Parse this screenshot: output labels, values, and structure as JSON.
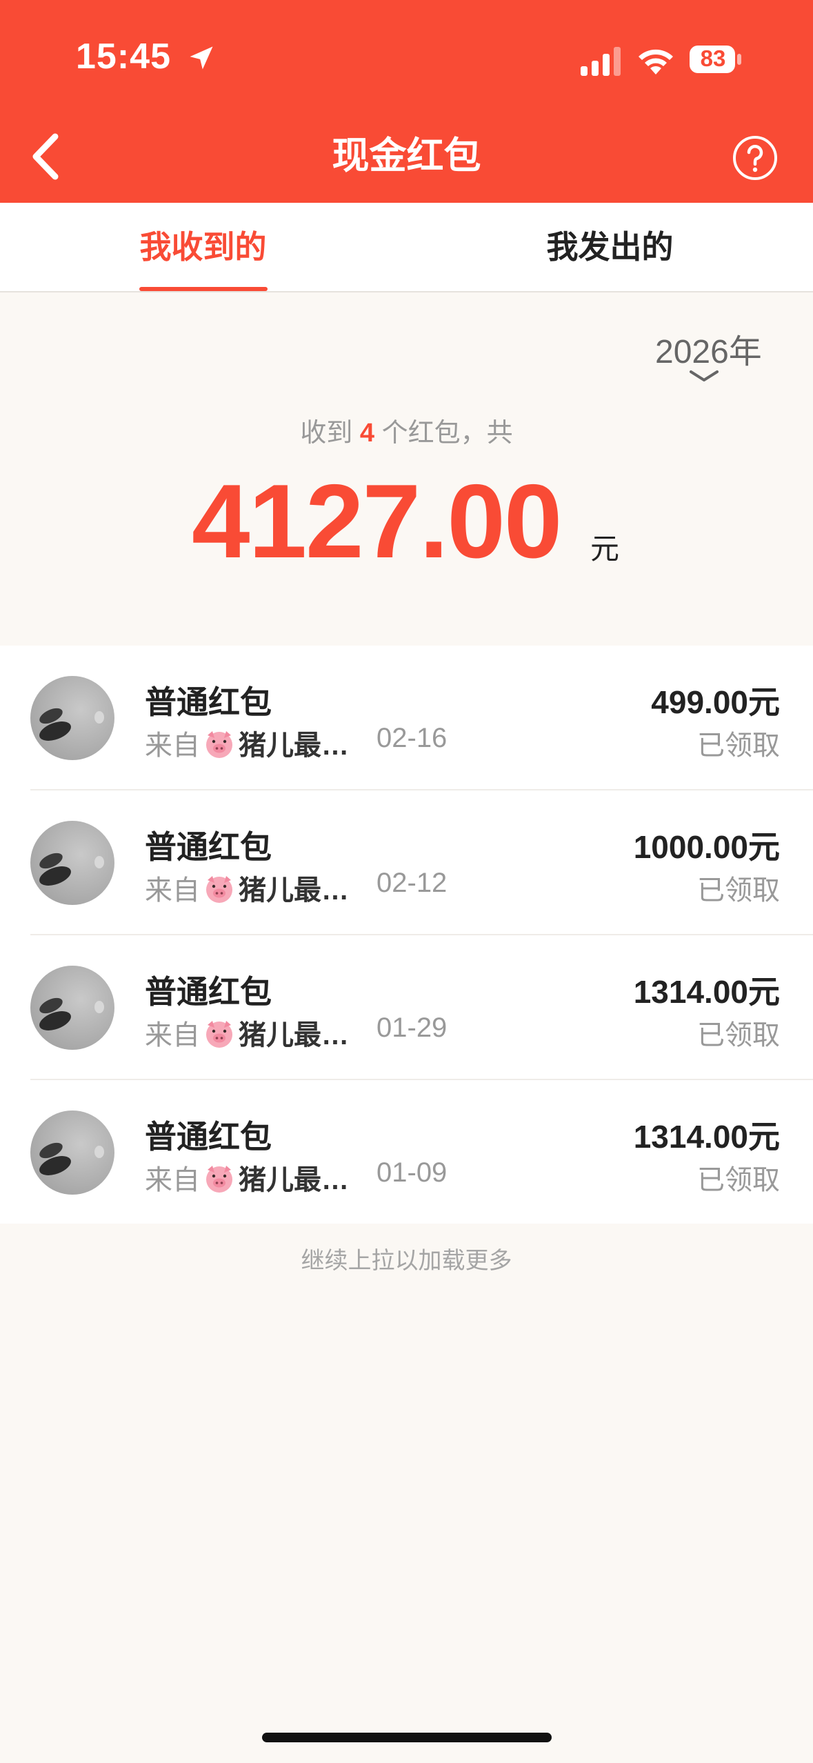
{
  "status_bar": {
    "time": "15:45",
    "battery": "83"
  },
  "nav": {
    "title": "现金红包"
  },
  "tabs": [
    {
      "label": "我收到的",
      "active": true
    },
    {
      "label": "我发出的",
      "active": false
    }
  ],
  "year_selector": {
    "value": "2026年"
  },
  "summary": {
    "prefix": "收到",
    "count": "4",
    "suffix": "个红包，共",
    "total": "4127.00",
    "unit": "元"
  },
  "records": [
    {
      "title": "普通红包",
      "from_prefix": "来自",
      "sender": "猪儿最…",
      "date": "02-16",
      "amount": "499.00元",
      "status": "已领取"
    },
    {
      "title": "普通红包",
      "from_prefix": "来自",
      "sender": "猪儿最…",
      "date": "02-12",
      "amount": "1000.00元",
      "status": "已领取"
    },
    {
      "title": "普通红包",
      "from_prefix": "来自",
      "sender": "猪儿最…",
      "date": "01-29",
      "amount": "1314.00元",
      "status": "已领取"
    },
    {
      "title": "普通红包",
      "from_prefix": "来自",
      "sender": "猪儿最…",
      "date": "01-09",
      "amount": "1314.00元",
      "status": "已领取"
    }
  ],
  "load_more": "继续上拉以加载更多",
  "colors": {
    "accent": "#F94B35",
    "background": "#FBF8F4"
  },
  "icons": {
    "back": "chevron-left-icon",
    "help": "question-circle-icon",
    "year_dropdown": "chevron-down-icon",
    "sender_emoji": "pig-face-icon"
  }
}
